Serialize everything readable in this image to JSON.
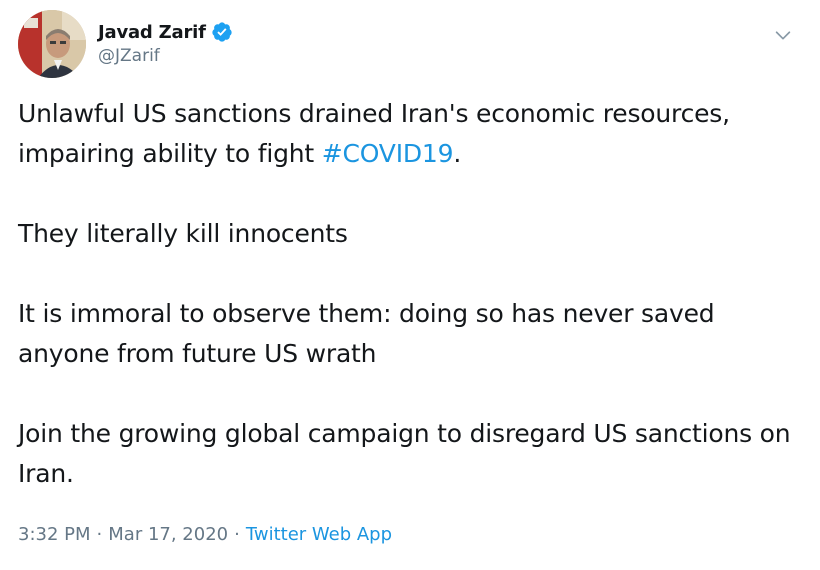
{
  "author": {
    "display_name": "Javad Zarif",
    "handle": "@JZarif",
    "verified": true,
    "avatar_icon": "profile-photo"
  },
  "tweet": {
    "p1_text": "Unlawful US sanctions drained Iran's economic resources, impairing ability to fight ",
    "p1_hashtag": "#COVID19",
    "p1_end": ".",
    "p2": "They literally kill innocents",
    "p3": "It is immoral to observe them: doing so has never saved anyone from future US wrath",
    "p4": "Join the growing global campaign to disregard US sanctions on Iran."
  },
  "meta": {
    "time": "3:32 PM",
    "separator": "·",
    "date": "Mar 17, 2020",
    "source": "Twitter Web App"
  },
  "colors": {
    "link": "#1b95e0",
    "muted": "#657786",
    "text": "#14171a",
    "verified_badge": "#1da1f2"
  },
  "icons": {
    "verified": "verified-badge-icon",
    "menu": "chevron-down-icon"
  }
}
